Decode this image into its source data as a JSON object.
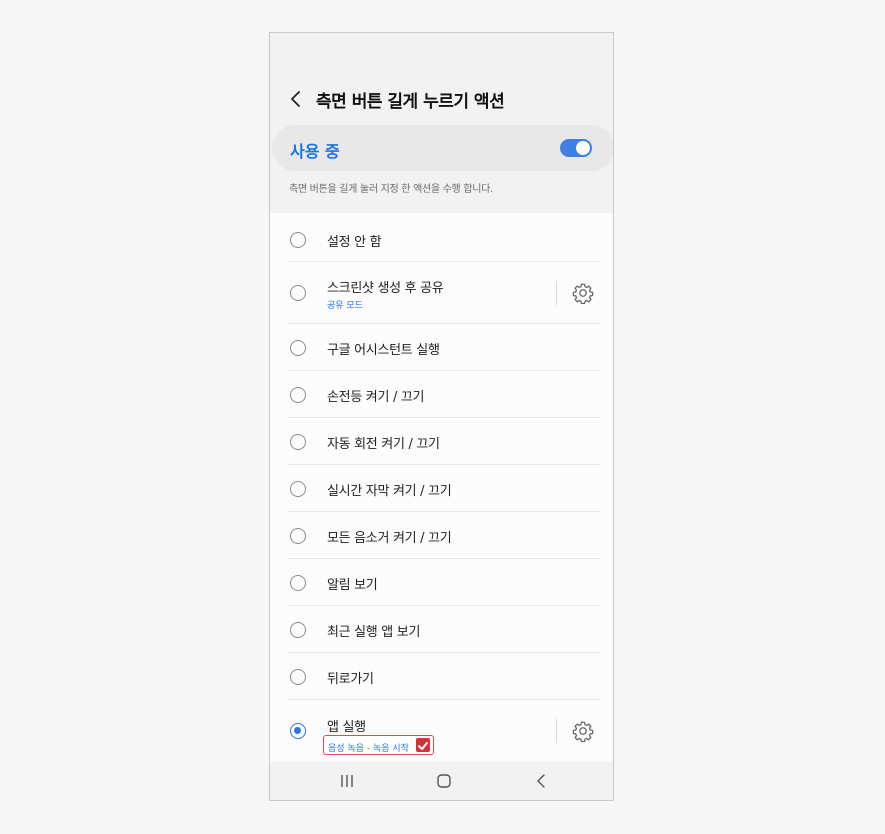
{
  "header": {
    "title": "측면 버튼 길게 누르기 액션"
  },
  "master": {
    "label": "사용 중",
    "enabled": true,
    "accent_color": "#1a73e8"
  },
  "description": "측면 버튼을 길게 눌러 지정 한 액션을 수행 합니다.",
  "options": [
    {
      "label": "설정 안 함",
      "selected": false
    },
    {
      "label": "스크린샷 생성 후 공유",
      "sub": "공유 모드",
      "selected": false,
      "has_settings": true
    },
    {
      "label": "구글 어시스턴트 실행",
      "selected": false
    },
    {
      "label": "손전등 켜기 / 끄기",
      "selected": false
    },
    {
      "label": "자동 회전 켜기 / 끄기",
      "selected": false
    },
    {
      "label": "실시간 자막 켜기 / 끄기",
      "selected": false
    },
    {
      "label": "모든 음소거 켜기 / 끄기",
      "selected": false
    },
    {
      "label": "알림 보기",
      "selected": false
    },
    {
      "label": "최근 실행 앱 보기",
      "selected": false
    },
    {
      "label": "뒤로가기",
      "selected": false
    },
    {
      "label": "앱 실행",
      "sub": "음성 녹음 - 녹음 시작",
      "selected": true,
      "has_settings": true,
      "highlighted": true
    }
  ],
  "navbar": {
    "recents_icon": "recents-icon",
    "home_icon": "home-icon",
    "back_icon": "back-icon"
  },
  "colors": {
    "accent": "#2a76e0",
    "highlight_border": "#e04a4a",
    "check_badge": "#d8303a"
  }
}
